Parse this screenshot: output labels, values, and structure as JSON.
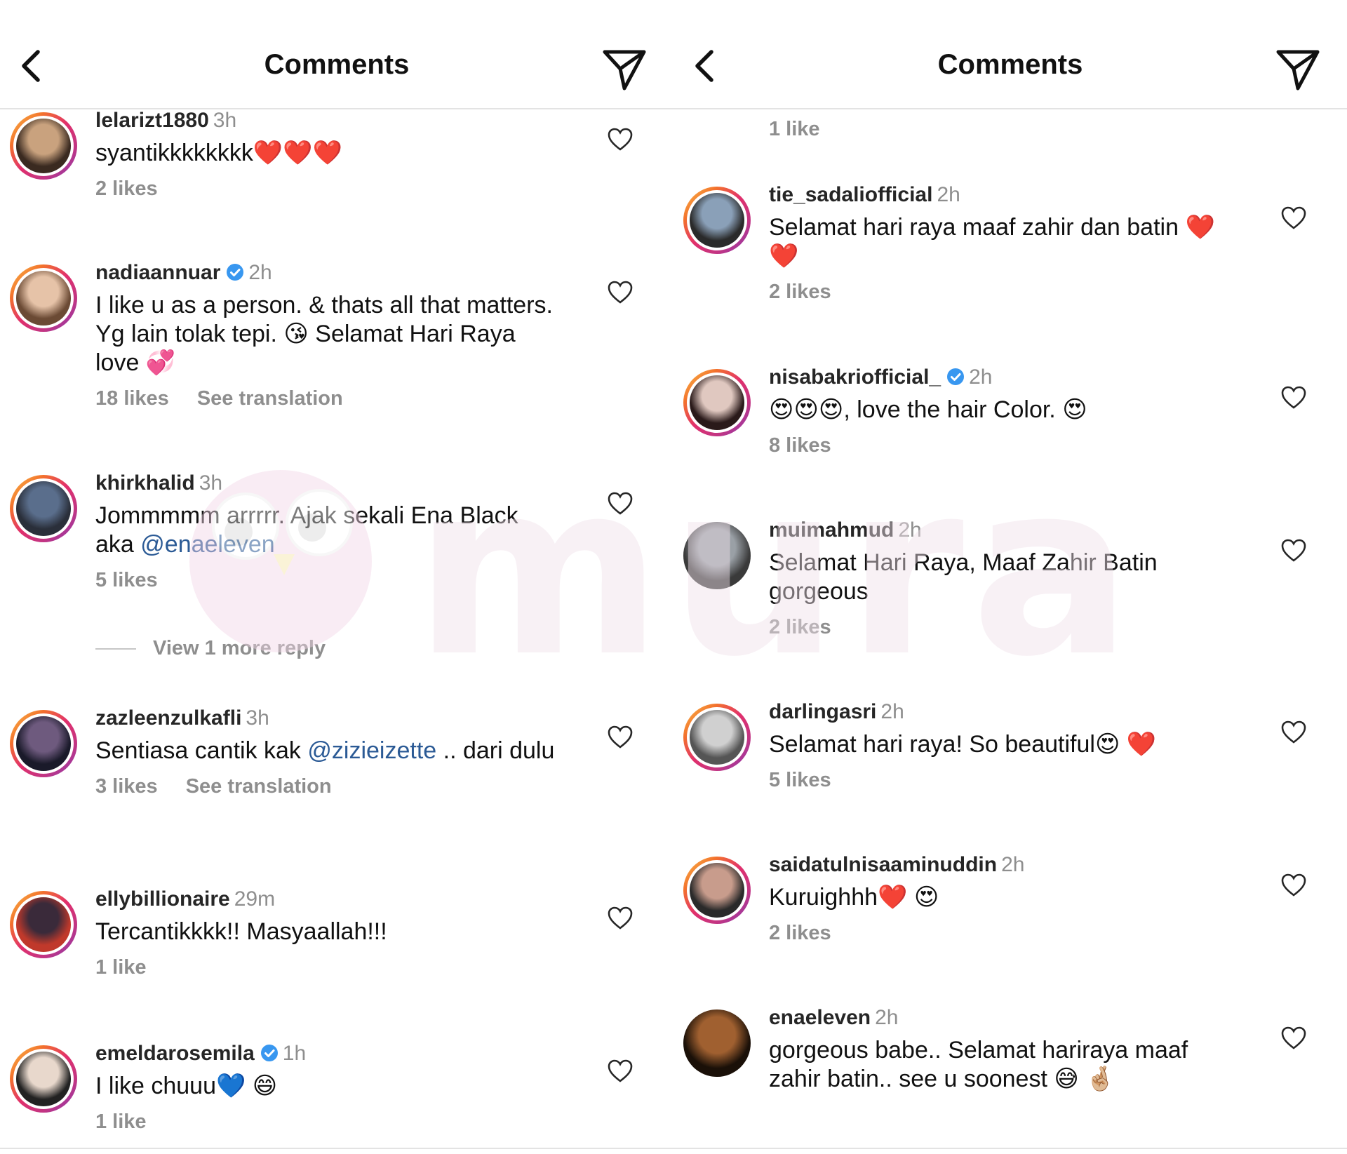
{
  "left": {
    "header": {
      "title": "Comments"
    },
    "comments": [
      {
        "username": "lelarizt1880",
        "verified": false,
        "time": "3h",
        "text_parts": [
          {
            "t": "syantikkkkkkkk"
          },
          {
            "e": "❤️"
          },
          {
            "e": "❤️"
          },
          {
            "e": "❤️"
          }
        ],
        "likes": "2 likes",
        "translation": ""
      },
      {
        "username": "nadiaannuar",
        "verified": true,
        "time": "2h",
        "text_parts": [
          {
            "t": "I like u as a person. & thats all that matters. Yg lain tolak tepi. "
          },
          {
            "e": "😘"
          },
          {
            "t": " Selamat Hari Raya love "
          },
          {
            "e": "💞"
          }
        ],
        "likes": "18 likes",
        "translation": "See translation"
      },
      {
        "username": "khirkhalid",
        "verified": false,
        "time": "3h",
        "text_parts": [
          {
            "t": "Jommmmm arrrrr. Ajak sekali Ena Black aka "
          },
          {
            "m": "@enaeleven"
          }
        ],
        "likes": "5 likes",
        "translation": "",
        "view_more": "View 1 more reply"
      },
      {
        "username": "zazleenzulkafli",
        "verified": false,
        "time": "3h",
        "text_parts": [
          {
            "t": "Sentiasa cantik kak "
          },
          {
            "m": "@zizieizette"
          },
          {
            "t": " .. dari dulu"
          }
        ],
        "likes": "3 likes",
        "translation": "See translation"
      },
      {
        "username": "ellybillionaire",
        "verified": false,
        "time": "29m",
        "text_parts": [
          {
            "t": "Tercantikkkk!! Masyaallah!!!"
          }
        ],
        "likes": "1 like",
        "translation": ""
      },
      {
        "username": "emeldarosemila",
        "verified": true,
        "time": "1h",
        "text_parts": [
          {
            "t": "I like chuuu"
          },
          {
            "e": "💙"
          },
          {
            "t": " "
          },
          {
            "e": "😄"
          }
        ],
        "likes": "1 like",
        "translation": ""
      }
    ]
  },
  "right": {
    "header": {
      "title": "Comments"
    },
    "top_likes": "1 like",
    "comments": [
      {
        "username": "tie_sadaliofficial",
        "verified": false,
        "time": "2h",
        "text_parts": [
          {
            "t": "Selamat hari raya maaf zahir dan batin "
          },
          {
            "e": "❤️"
          },
          {
            "e": "❤️"
          }
        ],
        "likes": "2 likes",
        "translation": ""
      },
      {
        "username": "nisabakriofficial_",
        "verified": true,
        "time": "2h",
        "text_parts": [
          {
            "e": "😍"
          },
          {
            "e": "😍"
          },
          {
            "e": "😍"
          },
          {
            "t": ", love the hair Color. "
          },
          {
            "e": "😍"
          }
        ],
        "likes": "8 likes",
        "translation": ""
      },
      {
        "username": "muimahmud",
        "verified": false,
        "time": "2h",
        "text_parts": [
          {
            "t": "Selamat Hari Raya, Maaf Zahir Batin gorgeous"
          }
        ],
        "likes": "2 likes",
        "translation": ""
      },
      {
        "username": "darlingasri",
        "verified": false,
        "time": "2h",
        "text_parts": [
          {
            "t": "Selamat hari raya! So beautiful"
          },
          {
            "e": "😍"
          },
          {
            "t": " "
          },
          {
            "e": "❤️"
          }
        ],
        "likes": "5 likes",
        "translation": ""
      },
      {
        "username": "saidatulnisaaminuddin",
        "verified": false,
        "time": "2h",
        "text_parts": [
          {
            "t": "Kuruighhh"
          },
          {
            "e": "❤️"
          },
          {
            "t": " "
          },
          {
            "e": "😍"
          }
        ],
        "likes": "2 likes",
        "translation": ""
      },
      {
        "username": "enaeleven",
        "verified": false,
        "time": "2h",
        "text_parts": [
          {
            "t": "gorgeous babe.. Selamat hariraya maaf zahir batin.. see u soonest "
          },
          {
            "e": "😅"
          },
          {
            "t": " "
          },
          {
            "e": "🤞🏼"
          }
        ],
        "likes": "",
        "translation": ""
      }
    ]
  },
  "watermark": {
    "text": "murai"
  },
  "colors": {
    "accent": "#2b5a95",
    "verified": "#3897f0",
    "muted": "#8e8e8e",
    "heart": "#e0245e"
  },
  "icons": {
    "back": "chevron-left-icon",
    "send": "paper-plane-icon",
    "like": "heart-outline-icon",
    "verified": "verified-badge-icon"
  }
}
